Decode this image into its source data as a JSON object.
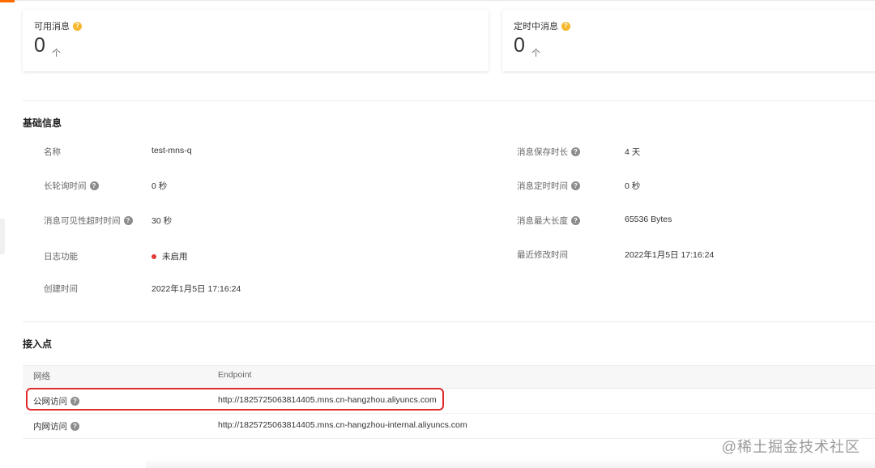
{
  "stats": {
    "available": {
      "label": "可用消息",
      "value": "0",
      "unit": "个",
      "help_icon": "question-circle-icon"
    },
    "scheduled": {
      "label": "定时中消息",
      "value": "0",
      "unit": "个",
      "help_icon": "question-circle-icon"
    }
  },
  "basic_info": {
    "title": "基础信息",
    "left": [
      {
        "label": "名称",
        "value": "test-mns-q"
      },
      {
        "label": "长轮询时间",
        "value": "0 秒"
      },
      {
        "label": "消息可见性超时时间",
        "value": "30 秒"
      },
      {
        "label": "日志功能",
        "value": "未启用"
      },
      {
        "label": "创建时间",
        "value": "2022年1月5日 17:16:24"
      }
    ],
    "right": [
      {
        "label": "消息保存时长",
        "value": "4 天"
      },
      {
        "label": "消息定时时间",
        "value": "0 秒"
      },
      {
        "label": "消息最大长度",
        "value": "65536 Bytes"
      },
      {
        "label": "最近修改时间",
        "value": "2022年1月5日 17:16:24"
      }
    ]
  },
  "endpoints": {
    "title": "接入点",
    "columns": [
      "网络",
      "Endpoint"
    ],
    "rows": [
      {
        "network": "公网访问",
        "endpoint": "http://1825725063814405.mns.cn-hangzhou.aliyuncs.com"
      },
      {
        "network": "内网访问",
        "endpoint": "http://1825725063814405.mns.cn-hangzhou-internal.aliyuncs.com"
      }
    ]
  },
  "watermark": "@稀土掘金技术社区",
  "colors": {
    "accent": "#ff6a00",
    "help_yellow": "#f5b72e",
    "status_red": "#e53935",
    "highlight": "#e02b2b"
  }
}
